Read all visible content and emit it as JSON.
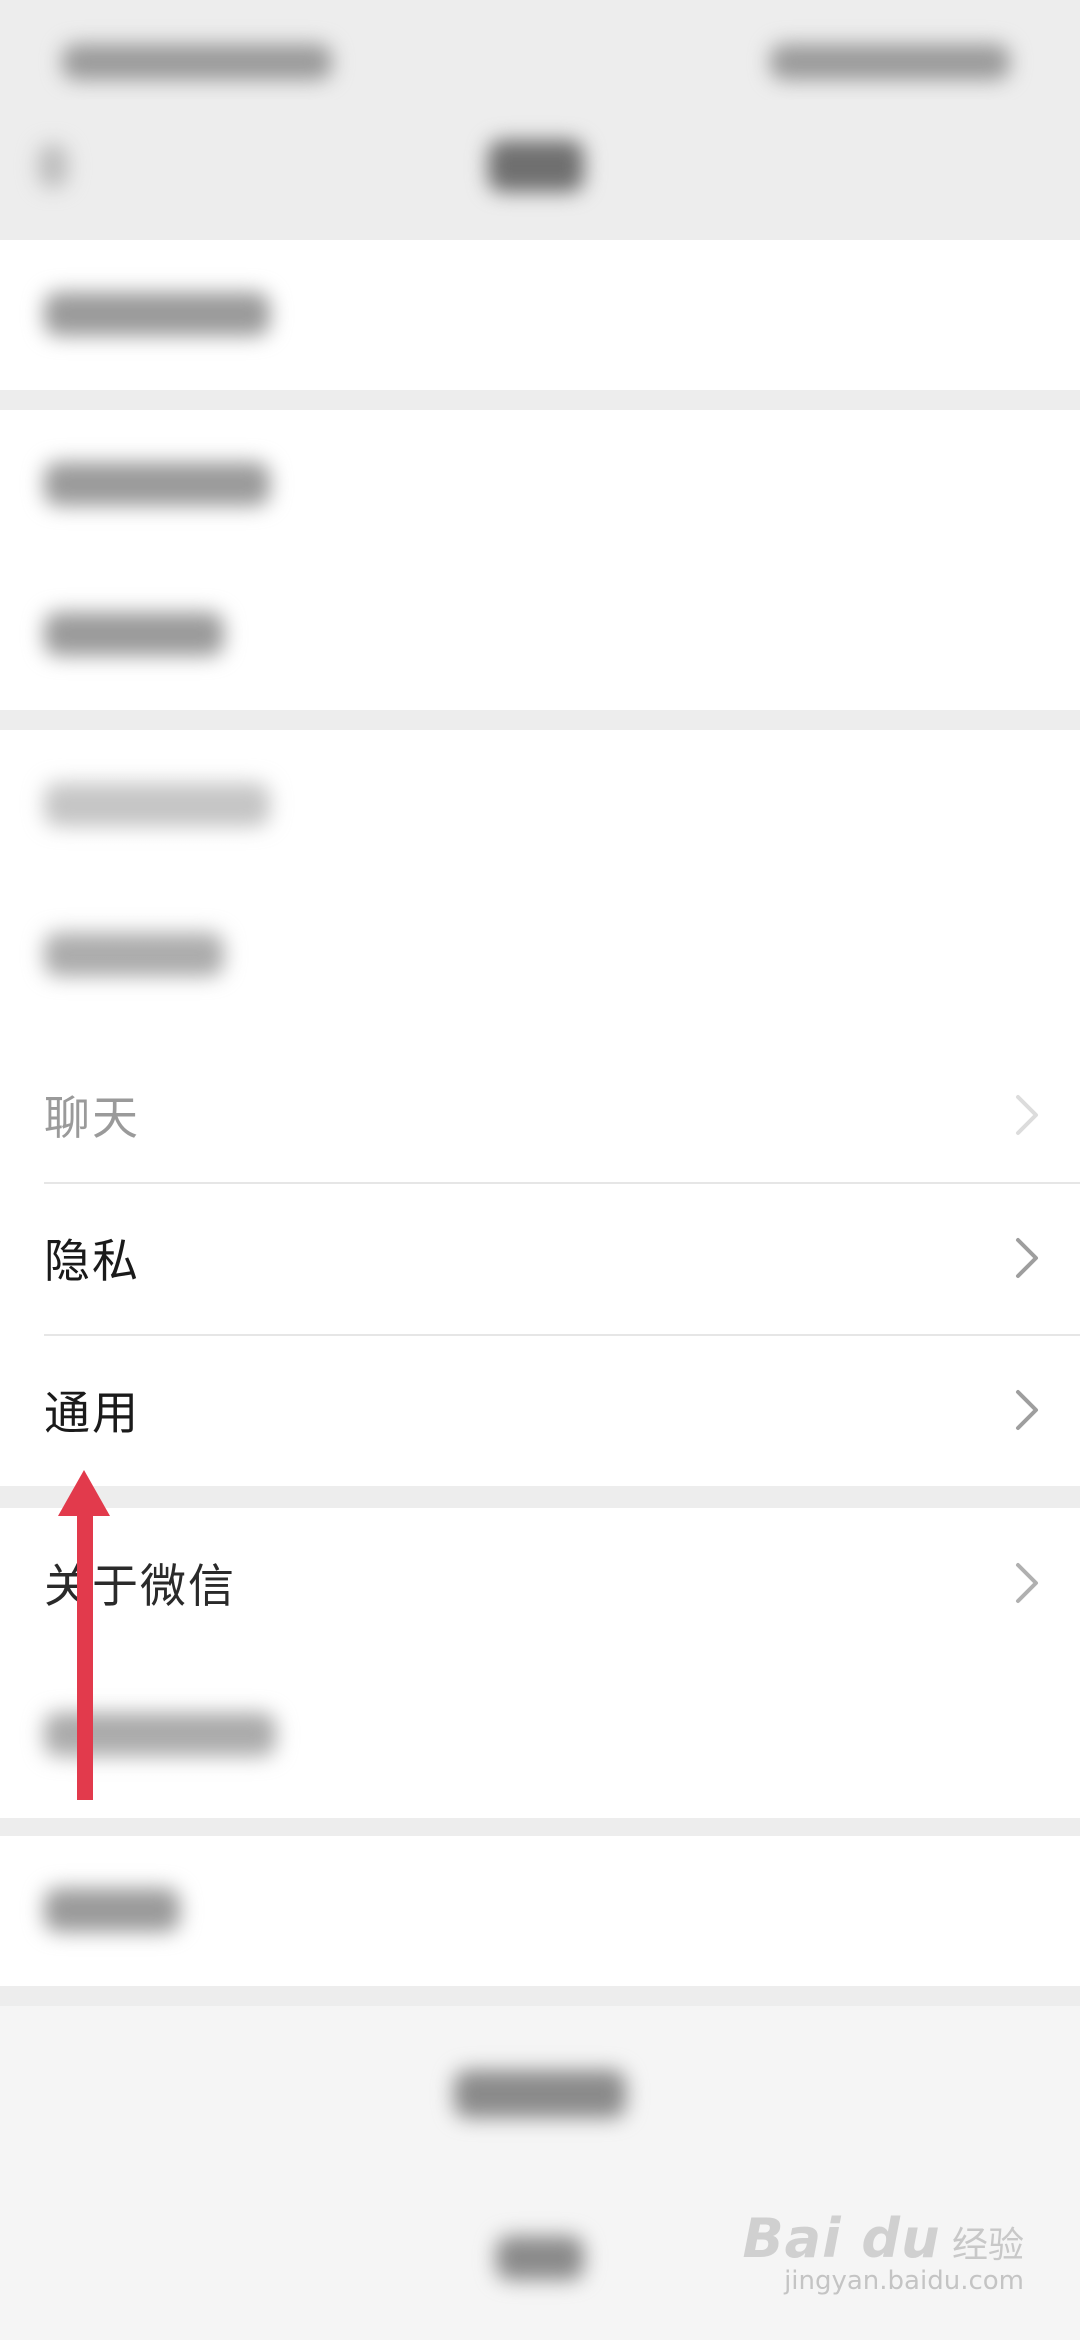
{
  "settings_list": {
    "rows": [
      {
        "label": "聊天"
      },
      {
        "label": "隐私"
      },
      {
        "label": "通用"
      },
      {
        "label": "关于微信"
      }
    ]
  },
  "icons": {
    "row_chevron": "chevron-right-icon",
    "annotation": "red-arrow-up-icon"
  },
  "colors": {
    "annotation_arrow": "#e23a4c",
    "page_background": "#ededed",
    "row_background": "#ffffff",
    "label_text": "#1a1a1a"
  },
  "watermark": {
    "brand": "Bai  du",
    "brand_suffix": "经验",
    "url": "jingyan.baidu.com"
  }
}
